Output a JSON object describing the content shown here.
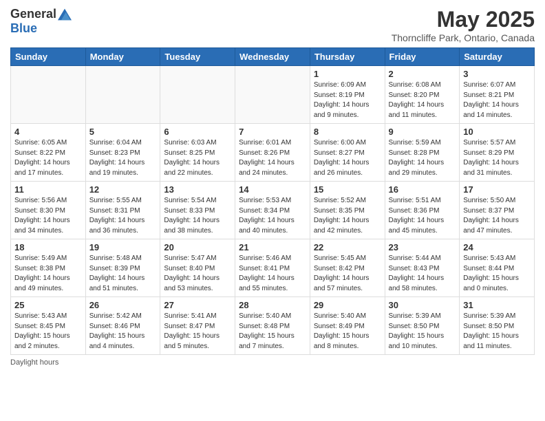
{
  "logo": {
    "general": "General",
    "blue": "Blue"
  },
  "title": "May 2025",
  "subtitle": "Thorncliffe Park, Ontario, Canada",
  "days_of_week": [
    "Sunday",
    "Monday",
    "Tuesday",
    "Wednesday",
    "Thursday",
    "Friday",
    "Saturday"
  ],
  "footer": "Daylight hours",
  "weeks": [
    [
      {
        "day": "",
        "info": ""
      },
      {
        "day": "",
        "info": ""
      },
      {
        "day": "",
        "info": ""
      },
      {
        "day": "",
        "info": ""
      },
      {
        "day": "1",
        "info": "Sunrise: 6:09 AM\nSunset: 8:19 PM\nDaylight: 14 hours\nand 9 minutes."
      },
      {
        "day": "2",
        "info": "Sunrise: 6:08 AM\nSunset: 8:20 PM\nDaylight: 14 hours\nand 11 minutes."
      },
      {
        "day": "3",
        "info": "Sunrise: 6:07 AM\nSunset: 8:21 PM\nDaylight: 14 hours\nand 14 minutes."
      }
    ],
    [
      {
        "day": "4",
        "info": "Sunrise: 6:05 AM\nSunset: 8:22 PM\nDaylight: 14 hours\nand 17 minutes."
      },
      {
        "day": "5",
        "info": "Sunrise: 6:04 AM\nSunset: 8:23 PM\nDaylight: 14 hours\nand 19 minutes."
      },
      {
        "day": "6",
        "info": "Sunrise: 6:03 AM\nSunset: 8:25 PM\nDaylight: 14 hours\nand 22 minutes."
      },
      {
        "day": "7",
        "info": "Sunrise: 6:01 AM\nSunset: 8:26 PM\nDaylight: 14 hours\nand 24 minutes."
      },
      {
        "day": "8",
        "info": "Sunrise: 6:00 AM\nSunset: 8:27 PM\nDaylight: 14 hours\nand 26 minutes."
      },
      {
        "day": "9",
        "info": "Sunrise: 5:59 AM\nSunset: 8:28 PM\nDaylight: 14 hours\nand 29 minutes."
      },
      {
        "day": "10",
        "info": "Sunrise: 5:57 AM\nSunset: 8:29 PM\nDaylight: 14 hours\nand 31 minutes."
      }
    ],
    [
      {
        "day": "11",
        "info": "Sunrise: 5:56 AM\nSunset: 8:30 PM\nDaylight: 14 hours\nand 34 minutes."
      },
      {
        "day": "12",
        "info": "Sunrise: 5:55 AM\nSunset: 8:31 PM\nDaylight: 14 hours\nand 36 minutes."
      },
      {
        "day": "13",
        "info": "Sunrise: 5:54 AM\nSunset: 8:33 PM\nDaylight: 14 hours\nand 38 minutes."
      },
      {
        "day": "14",
        "info": "Sunrise: 5:53 AM\nSunset: 8:34 PM\nDaylight: 14 hours\nand 40 minutes."
      },
      {
        "day": "15",
        "info": "Sunrise: 5:52 AM\nSunset: 8:35 PM\nDaylight: 14 hours\nand 42 minutes."
      },
      {
        "day": "16",
        "info": "Sunrise: 5:51 AM\nSunset: 8:36 PM\nDaylight: 14 hours\nand 45 minutes."
      },
      {
        "day": "17",
        "info": "Sunrise: 5:50 AM\nSunset: 8:37 PM\nDaylight: 14 hours\nand 47 minutes."
      }
    ],
    [
      {
        "day": "18",
        "info": "Sunrise: 5:49 AM\nSunset: 8:38 PM\nDaylight: 14 hours\nand 49 minutes."
      },
      {
        "day": "19",
        "info": "Sunrise: 5:48 AM\nSunset: 8:39 PM\nDaylight: 14 hours\nand 51 minutes."
      },
      {
        "day": "20",
        "info": "Sunrise: 5:47 AM\nSunset: 8:40 PM\nDaylight: 14 hours\nand 53 minutes."
      },
      {
        "day": "21",
        "info": "Sunrise: 5:46 AM\nSunset: 8:41 PM\nDaylight: 14 hours\nand 55 minutes."
      },
      {
        "day": "22",
        "info": "Sunrise: 5:45 AM\nSunset: 8:42 PM\nDaylight: 14 hours\nand 57 minutes."
      },
      {
        "day": "23",
        "info": "Sunrise: 5:44 AM\nSunset: 8:43 PM\nDaylight: 14 hours\nand 58 minutes."
      },
      {
        "day": "24",
        "info": "Sunrise: 5:43 AM\nSunset: 8:44 PM\nDaylight: 15 hours\nand 0 minutes."
      }
    ],
    [
      {
        "day": "25",
        "info": "Sunrise: 5:43 AM\nSunset: 8:45 PM\nDaylight: 15 hours\nand 2 minutes."
      },
      {
        "day": "26",
        "info": "Sunrise: 5:42 AM\nSunset: 8:46 PM\nDaylight: 15 hours\nand 4 minutes."
      },
      {
        "day": "27",
        "info": "Sunrise: 5:41 AM\nSunset: 8:47 PM\nDaylight: 15 hours\nand 5 minutes."
      },
      {
        "day": "28",
        "info": "Sunrise: 5:40 AM\nSunset: 8:48 PM\nDaylight: 15 hours\nand 7 minutes."
      },
      {
        "day": "29",
        "info": "Sunrise: 5:40 AM\nSunset: 8:49 PM\nDaylight: 15 hours\nand 8 minutes."
      },
      {
        "day": "30",
        "info": "Sunrise: 5:39 AM\nSunset: 8:50 PM\nDaylight: 15 hours\nand 10 minutes."
      },
      {
        "day": "31",
        "info": "Sunrise: 5:39 AM\nSunset: 8:50 PM\nDaylight: 15 hours\nand 11 minutes."
      }
    ]
  ]
}
